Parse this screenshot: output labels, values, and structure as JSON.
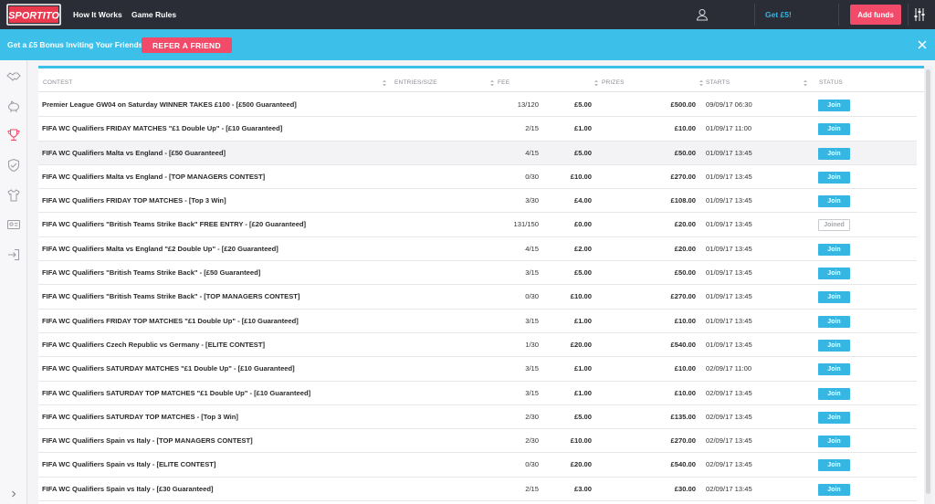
{
  "app": {
    "brand_color": "#2b2d36",
    "accent": "#3cc0e9",
    "cta_color": "#f24b6a"
  },
  "logo": {
    "text": "SPORTITO",
    "icon": "logo"
  },
  "nav": {
    "how_it_works": "How It Works",
    "game_rules": "Game Rules"
  },
  "header": {
    "user_icon": "user-icon",
    "get5": "Get £5!",
    "add_funds": "Add funds",
    "settings_icon": "sliders-icon"
  },
  "banner": {
    "text": "Get a £5 Bonus Inviting Your Friends",
    "cta": "REFER A FRIEND",
    "close_icon": "close-icon"
  },
  "sidebar": {
    "icons": [
      "handshake-icon",
      "piggy-bank-icon",
      "trophy-icon",
      "shield-icon",
      "shirt-icon",
      "id-card-icon",
      "logout-icon"
    ],
    "expand_icon": "chevron-right-icon"
  },
  "table": {
    "columns": {
      "contest": "CONTEST",
      "entries": "ENTRIES/SIZE",
      "fee": "FEE",
      "prizes": "PRIZES",
      "starts": "STARTS",
      "status": "STATUS"
    },
    "rows": [
      {
        "name": "Premier League GW04 on Saturday WINNER TAKES £100 - [£500 Guaranteed]",
        "entries": "13/120",
        "fee": "£5.00",
        "prize": "£500.00",
        "starts": "09/09/17 06:30",
        "status": "Join"
      },
      {
        "name": "FIFA WC Qualifiers FRIDAY MATCHES \"£1 Double Up\" - [£10 Guaranteed]",
        "entries": "2/15",
        "fee": "£1.00",
        "prize": "£10.00",
        "starts": "01/09/17 11:00",
        "status": "Join"
      },
      {
        "name": "FIFA WC Qualifiers Malta vs England - [£50 Guaranteed]",
        "entries": "4/15",
        "fee": "£5.00",
        "prize": "£50.00",
        "starts": "01/09/17 13:45",
        "status": "Join"
      },
      {
        "name": "FIFA WC Qualifiers Malta vs England - [TOP MANAGERS CONTEST]",
        "entries": "0/30",
        "fee": "£10.00",
        "prize": "£270.00",
        "starts": "01/09/17 13:45",
        "status": "Join"
      },
      {
        "name": "FIFA WC Qualifiers FRIDAY TOP MATCHES - [Top 3 Win]",
        "entries": "3/30",
        "fee": "£4.00",
        "prize": "£108.00",
        "starts": "01/09/17 13:45",
        "status": "Join"
      },
      {
        "name": "FIFA WC Qualifiers \"British Teams Strike Back\" FREE ENTRY - [£20 Guaranteed]",
        "entries": "131/150",
        "fee": "£0.00",
        "prize": "£20.00",
        "starts": "01/09/17 13:45",
        "status": "Joined"
      },
      {
        "name": "FIFA WC Qualifiers Malta vs England \"£2 Double Up\" - [£20 Guaranteed]",
        "entries": "4/15",
        "fee": "£2.00",
        "prize": "£20.00",
        "starts": "01/09/17 13:45",
        "status": "Join"
      },
      {
        "name": "FIFA WC Qualifiers \"British Teams Strike Back\" - [£50 Guaranteed]",
        "entries": "3/15",
        "fee": "£5.00",
        "prize": "£50.00",
        "starts": "01/09/17 13:45",
        "status": "Join"
      },
      {
        "name": "FIFA WC Qualifiers \"British Teams Strike Back\" - [TOP MANAGERS CONTEST]",
        "entries": "0/30",
        "fee": "£10.00",
        "prize": "£270.00",
        "starts": "01/09/17 13:45",
        "status": "Join"
      },
      {
        "name": "FIFA WC Qualifiers FRIDAY TOP MATCHES \"£1 Double Up\" - [£10 Guaranteed]",
        "entries": "3/15",
        "fee": "£1.00",
        "prize": "£10.00",
        "starts": "01/09/17 13:45",
        "status": "Join"
      },
      {
        "name": "FIFA WC Qualifiers Czech Republic vs Germany - [ELITE CONTEST]",
        "entries": "1/30",
        "fee": "£20.00",
        "prize": "£540.00",
        "starts": "01/09/17 13:45",
        "status": "Join"
      },
      {
        "name": "FIFA WC Qualifiers SATURDAY MATCHES \"£1 Double Up\" - [£10 Guaranteed]",
        "entries": "3/15",
        "fee": "£1.00",
        "prize": "£10.00",
        "starts": "02/09/17 11:00",
        "status": "Join"
      },
      {
        "name": "FIFA WC Qualifiers SATURDAY TOP MATCHES \"£1 Double Up\" - [£10 Guaranteed]",
        "entries": "3/15",
        "fee": "£1.00",
        "prize": "£10.00",
        "starts": "02/09/17 13:45",
        "status": "Join"
      },
      {
        "name": "FIFA WC Qualifiers SATURDAY TOP MATCHES - [Top 3 Win]",
        "entries": "2/30",
        "fee": "£5.00",
        "prize": "£135.00",
        "starts": "02/09/17 13:45",
        "status": "Join"
      },
      {
        "name": "FIFA WC Qualifiers Spain vs Italy - [TOP MANAGERS CONTEST]",
        "entries": "2/30",
        "fee": "£10.00",
        "prize": "£270.00",
        "starts": "02/09/17 13:45",
        "status": "Join"
      },
      {
        "name": "FIFA WC Qualifiers Spain vs Italy - [ELITE CONTEST]",
        "entries": "0/30",
        "fee": "£20.00",
        "prize": "£540.00",
        "starts": "02/09/17 13:45",
        "status": "Join"
      },
      {
        "name": "FIFA WC Qualifiers Spain vs Italy - [£30 Guaranteed]",
        "entries": "2/15",
        "fee": "£3.00",
        "prize": "£30.00",
        "starts": "02/09/17 13:45",
        "status": "Join"
      }
    ]
  }
}
